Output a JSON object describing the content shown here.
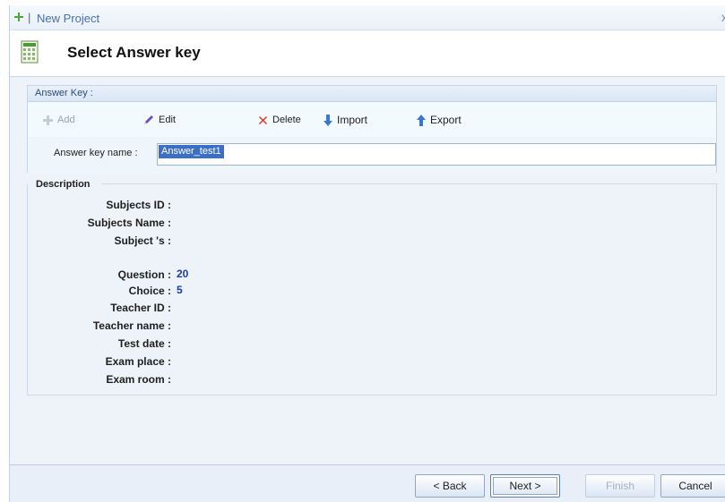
{
  "window": {
    "title": "New Project",
    "close_glyph": "x"
  },
  "header": {
    "title": "Select Answer key",
    "icon": "document-grid-icon"
  },
  "answer_key_group": {
    "title": "Answer Key :",
    "toolbar": {
      "add": {
        "label": "Add",
        "icon": "plus-icon",
        "enabled": false
      },
      "edit": {
        "label": "Edit",
        "icon": "pencil-icon",
        "enabled": true
      },
      "delete": {
        "label": "Delete",
        "icon": "delete-x-icon",
        "enabled": true
      },
      "import": {
        "label": "Import",
        "icon": "arrow-down-icon",
        "enabled": true
      },
      "export": {
        "label": "Export",
        "icon": "arrow-up-icon",
        "enabled": true
      }
    },
    "name_field": {
      "label": "Answer key name :",
      "value": "Answer_test1"
    }
  },
  "description": {
    "title": "Description",
    "rows": [
      {
        "label": "Subjects ID :",
        "value": ""
      },
      {
        "label": "Subjects Name :",
        "value": ""
      },
      {
        "label": "Subject 's :",
        "value": ""
      },
      {
        "label": "Question :",
        "value": "20"
      },
      {
        "label": "Choice :",
        "value": "5"
      },
      {
        "label": "Teacher ID :",
        "value": ""
      },
      {
        "label": "Teacher name :",
        "value": ""
      },
      {
        "label": "Test date :",
        "value": ""
      },
      {
        "label": "Exam place :",
        "value": ""
      },
      {
        "label": "Exam room :",
        "value": ""
      }
    ]
  },
  "footer": {
    "back": {
      "label": "< Back",
      "enabled": true
    },
    "next": {
      "label": "Next >",
      "enabled": true
    },
    "finish": {
      "label": "Finish",
      "enabled": false
    },
    "cancel": {
      "label": "Cancel",
      "enabled": true
    }
  },
  "colors": {
    "accent": "#3a6fc4",
    "value_text": "#1a3ea0",
    "background": "#eef3f9"
  }
}
